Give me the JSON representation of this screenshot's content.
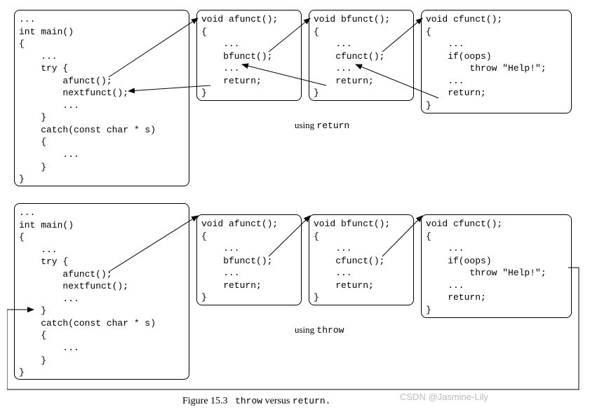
{
  "row1": {
    "main": "...\nint main()\n{\n    ...\n    try {\n        afunct();\n        nextfunct();\n        ...\n    }\n    catch(const char * s)\n    {\n        ...\n    }\n}",
    "a": "void afunct();\n{\n    ...\n    bfunct();\n    ...\n    return;\n}",
    "b": "void bfunct();\n{\n    ...\n    cfunct();\n    ...\n    return;\n}",
    "c": "void cfunct();\n{\n    ...\n    if(oops)\n        throw \"Help!\";\n    ...\n    return;\n}"
  },
  "row2": {
    "main": "...\nint main()\n{\n    ...\n    try {\n        afunct();\n        nextfunct();\n        ...\n    }\n    catch(const char * s)\n    {\n        ...\n    }\n}",
    "a": "void afunct();\n{\n    ...\n    bfunct();\n    ...\n    return;\n}",
    "b": "void bfunct();\n{\n    ...\n    cfunct();\n    ...\n    return;\n}",
    "c": "void cfunct();\n{\n    ...\n    if(oops)\n        throw \"Help!\";\n    ...\n    return;\n}"
  },
  "labels": {
    "return": "using return",
    "throw": "using throw"
  },
  "caption": {
    "pre": "Figure 15.3",
    "mid": "throw",
    "conj": "versus",
    "end": "return."
  },
  "watermark": "CSDN @Jasmine-Lily"
}
